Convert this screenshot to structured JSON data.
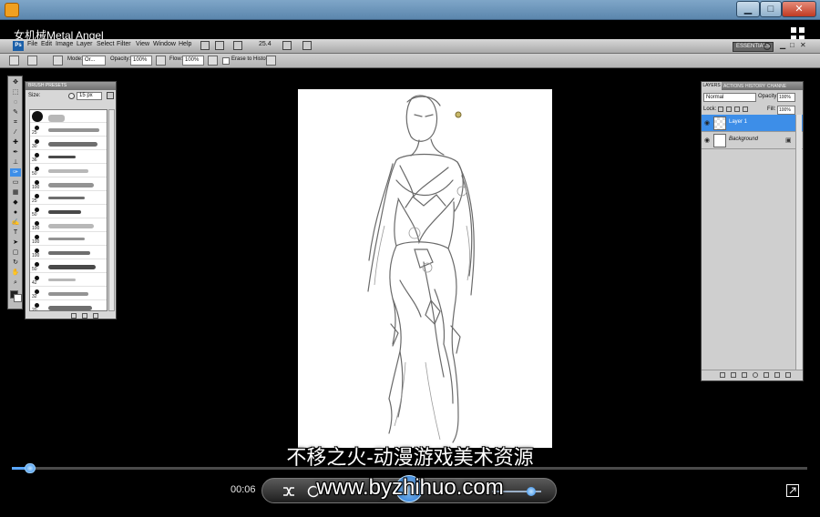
{
  "window": {
    "app_icon": "media-player-icon",
    "minimize": "▁",
    "maximize": "□",
    "close": "✕"
  },
  "player": {
    "title": "女机械Metal Angel",
    "time": "00:06",
    "progress": 0.02
  },
  "photoshop": {
    "menu": [
      "File",
      "Edit",
      "Image",
      "Layer",
      "Select",
      "Filter",
      "View",
      "Window",
      "Help"
    ],
    "zoom": "25.4",
    "workspace_button": "ESSENTIALS",
    "options": {
      "mode_label": "Mode:",
      "mode_value": "Or...",
      "opacity_label": "Opacity:",
      "opacity_value": "100%",
      "flow_label": "Flow:",
      "flow_value": "100%",
      "history_label": "Erase to History"
    },
    "brush_panel": {
      "title": "BRUSH PRESETS",
      "size_label": "Size:",
      "size_value": "15 px",
      "numbers": [
        "",
        "25",
        "30",
        "36",
        "50",
        "100",
        "25",
        "50",
        "100",
        "100",
        "100",
        "50",
        "42",
        "32",
        "20",
        "60",
        "100",
        "32",
        "100",
        "100",
        "100",
        "80",
        "100",
        "100"
      ]
    },
    "layers_panel": {
      "tabs": [
        "LAYERS",
        "ACTIONS",
        "HISTORY",
        "CHANNE"
      ],
      "blend_mode": "Normal",
      "opacity_label": "Opacity:",
      "opacity_value": "100%",
      "lock_label": "Lock:",
      "fill_label": "Fill:",
      "fill_value": "100%",
      "layers": [
        {
          "name": "Layer 1",
          "selected": true
        },
        {
          "name": "Background",
          "selected": false
        }
      ]
    }
  },
  "overlay": {
    "caption": "不移之火-动漫游戏美术资源",
    "watermark": "www.byzhihuo.com"
  },
  "colors": {
    "selection_blue": "#3d8ee8",
    "seek_blue": "#5aa7ff"
  }
}
